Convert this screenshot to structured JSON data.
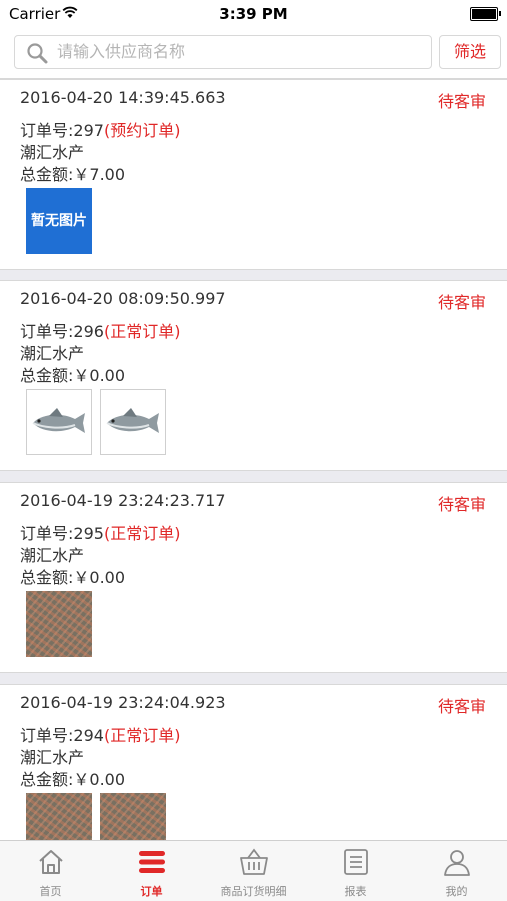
{
  "status_bar": {
    "carrier": "Carrier",
    "time": "3:39 PM"
  },
  "search": {
    "placeholder": "请输入供应商名称",
    "filter_label": "筛选"
  },
  "orders": [
    {
      "datetime": "2016-04-20 14:39:45.663",
      "status": "待客审",
      "order_no_label": "订单号:",
      "order_no": "297",
      "order_type": "(预约订单)",
      "supplier": "潮汇水产",
      "total_label": "总金额:",
      "total": "￥7.00",
      "thumbnails": [
        {
          "type": "no-image",
          "text": "暂无图片"
        }
      ]
    },
    {
      "datetime": "2016-04-20 08:09:50.997",
      "status": "待客审",
      "order_no_label": "订单号:",
      "order_no": "296",
      "order_type": "(正常订单)",
      "supplier": "潮汇水产",
      "total_label": "总金额:",
      "total": "￥0.00",
      "thumbnails": [
        {
          "type": "fish"
        },
        {
          "type": "fish"
        }
      ]
    },
    {
      "datetime": "2016-04-19 23:24:23.717",
      "status": "待客审",
      "order_no_label": "订单号:",
      "order_no": "295",
      "order_type": "(正常订单)",
      "supplier": "潮汇水产",
      "total_label": "总金额:",
      "total": "￥0.00",
      "thumbnails": [
        {
          "type": "shrimp"
        }
      ]
    },
    {
      "datetime": "2016-04-19 23:24:04.923",
      "status": "待客审",
      "order_no_label": "订单号:",
      "order_no": "294",
      "order_type": "(正常订单)",
      "supplier": "潮汇水产",
      "total_label": "总金额:",
      "total": "￥0.00",
      "thumbnails": [
        {
          "type": "shrimp"
        },
        {
          "type": "shrimp"
        }
      ]
    }
  ],
  "tab_bar": [
    {
      "label": "首页",
      "icon": "home-icon",
      "active": false
    },
    {
      "label": "订单",
      "icon": "order-list-icon",
      "active": true
    },
    {
      "label": "商品订货明细",
      "icon": "basket-icon",
      "active": false
    },
    {
      "label": "报表",
      "icon": "report-icon",
      "active": false
    },
    {
      "label": "我的",
      "icon": "user-icon",
      "active": false
    }
  ],
  "colors": {
    "accent": "#e02828",
    "inactive_tab": "#8a8a8a",
    "no_image_bg": "#1f6fd4"
  }
}
